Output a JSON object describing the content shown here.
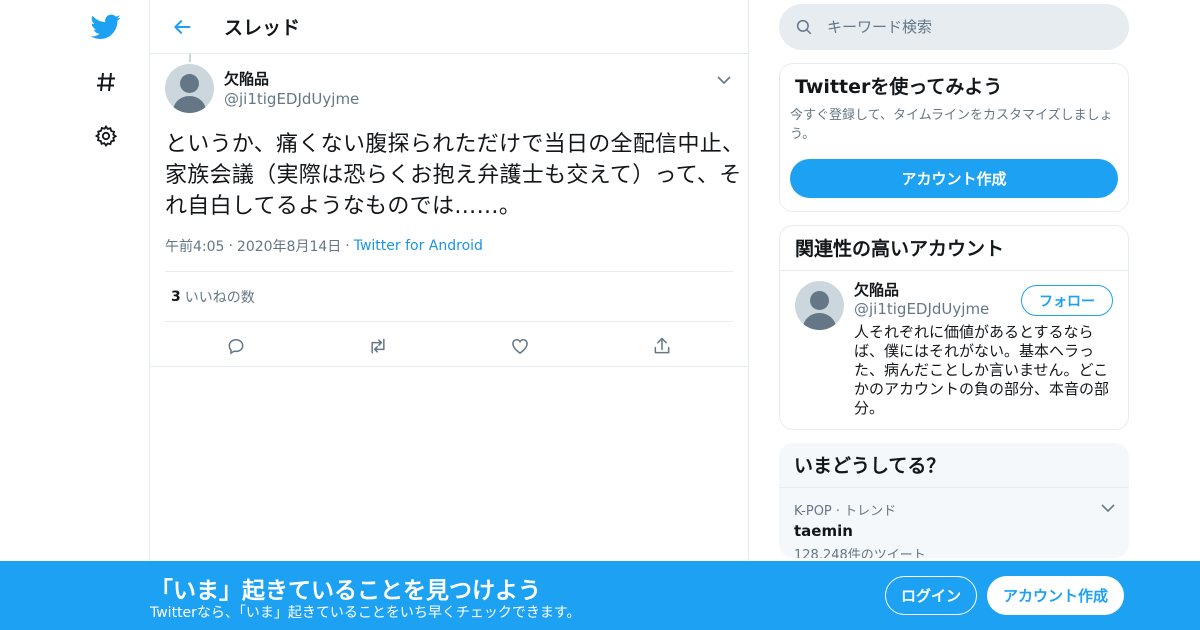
{
  "nav": {
    "logo": "twitter-bird-icon",
    "explore": "hashtag-icon",
    "settings": "gear-icon",
    "brand_color": "#1da1f2"
  },
  "header": {
    "title": "スレッド"
  },
  "tweet": {
    "display_name": "欠陥品",
    "screen_name": "@ji1tigEDJdUyjme",
    "text": "というか、痛くない腹探られただけで当日の全配信中止、家族会議（実際は恐らくお抱え弁護士も交えて）って、それ自白してるようなものでは……。",
    "time": "午前4:05",
    "date": "2020年8月14日",
    "source": "Twitter for Android",
    "likes_count": "3",
    "likes_label": "いいねの数"
  },
  "search": {
    "placeholder": "キーワード検索"
  },
  "signup_card": {
    "title": "Twitterを使ってみよう",
    "desc": "今すぐ登録して、タイムラインをカスタマイズしましょう。",
    "button": "アカウント作成"
  },
  "related_card": {
    "title": "関連性の高いアカウント",
    "name": "欠陥品",
    "handle": "@ji1tigEDJdUyjme",
    "follow": "フォロー",
    "bio": "人それぞれに価値があるとするならば、僕にはそれがない。基本ヘラった、病んだことしか言いません。どこかのアカウントの負の部分、本音の部分。"
  },
  "trends_card": {
    "title": "いまどうしてる？",
    "trend_meta": "K-POP · トレンド",
    "trend_name": "taemin",
    "trend_count": "128,248件のツイート"
  },
  "banner": {
    "title": "「いま」起きていることを見つけよう",
    "sub": "Twitterなら、「いま」起きていることをいち早くチェックできます。",
    "login": "ログイン",
    "signup": "アカウント作成"
  }
}
